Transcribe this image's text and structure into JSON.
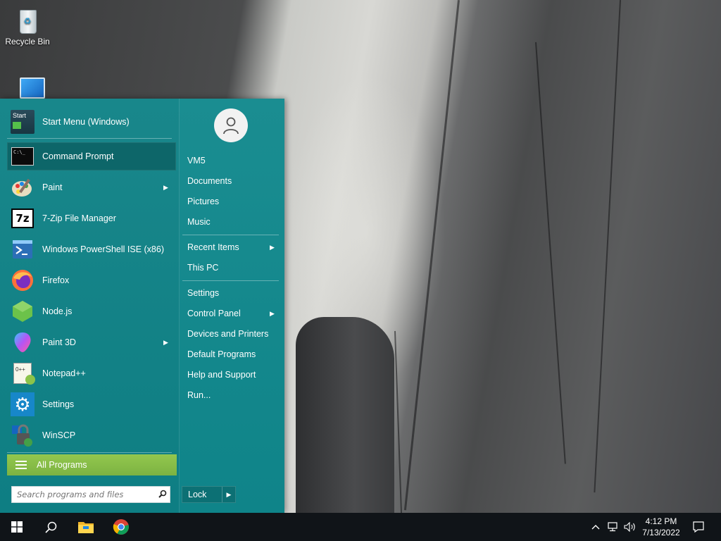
{
  "desktop": {
    "icons": [
      {
        "label": "Recycle Bin",
        "icon": "recycle-bin-icon"
      }
    ]
  },
  "start_menu": {
    "programs": [
      {
        "label": "Start Menu (Windows)",
        "icon": "start-menu-app-icon",
        "submenu": false,
        "selected": false
      },
      {
        "label": "Command Prompt",
        "icon": "command-prompt-icon",
        "submenu": false,
        "selected": true
      },
      {
        "label": "Paint",
        "icon": "paint-icon",
        "submenu": true,
        "selected": false
      },
      {
        "label": "7-Zip File Manager",
        "icon": "seven-zip-icon",
        "submenu": false,
        "selected": false
      },
      {
        "label": "Windows PowerShell ISE (x86)",
        "icon": "powershell-icon",
        "submenu": false,
        "selected": false
      },
      {
        "label": "Firefox",
        "icon": "firefox-icon",
        "submenu": false,
        "selected": false
      },
      {
        "label": "Node.js",
        "icon": "nodejs-icon",
        "submenu": false,
        "selected": false
      },
      {
        "label": "Paint 3D",
        "icon": "paint-3d-icon",
        "submenu": true,
        "selected": false
      },
      {
        "label": "Notepad++",
        "icon": "notepad-plus-plus-icon",
        "submenu": false,
        "selected": false
      },
      {
        "label": "Settings",
        "icon": "settings-gear-icon",
        "submenu": false,
        "selected": false
      },
      {
        "label": "WinSCP",
        "icon": "winscp-icon",
        "submenu": false,
        "selected": false
      }
    ],
    "start_icon_text": "Start",
    "cmd_icon_text": "C:\\_",
    "seven_zip_icon_text": "7z",
    "notepad_icon_text": "0++",
    "all_programs_label": "All Programs",
    "search_placeholder": "Search programs and files",
    "places": [
      {
        "label": "VM5",
        "submenu": false
      },
      {
        "label": "Documents",
        "submenu": false
      },
      {
        "label": "Pictures",
        "submenu": false
      },
      {
        "label": "Music",
        "submenu": false
      },
      {
        "label": "Recent Items",
        "submenu": true
      },
      {
        "label": "This PC",
        "submenu": false
      },
      {
        "label": "Settings",
        "submenu": false
      },
      {
        "label": "Control Panel",
        "submenu": true
      },
      {
        "label": "Devices and Printers",
        "submenu": false
      },
      {
        "label": "Default Programs",
        "submenu": false
      },
      {
        "label": "Help and Support",
        "submenu": false
      },
      {
        "label": "Run...",
        "submenu": false
      }
    ],
    "lock_label": "Lock",
    "arrow_glyph": "▶"
  },
  "taskbar": {
    "time": "4:12 PM",
    "date": "7/13/2022",
    "pinned": [
      "windows-start-icon",
      "search-icon",
      "file-explorer-icon",
      "chrome-icon"
    ],
    "tray": [
      "chevron-up-icon",
      "network-icon",
      "volume-icon",
      "notification-icon"
    ]
  },
  "colors": {
    "menu_bg": "#16898d",
    "selected_bg": "#0d6669",
    "all_programs_bg": "#8bc34a",
    "taskbar_bg": "#101418"
  }
}
